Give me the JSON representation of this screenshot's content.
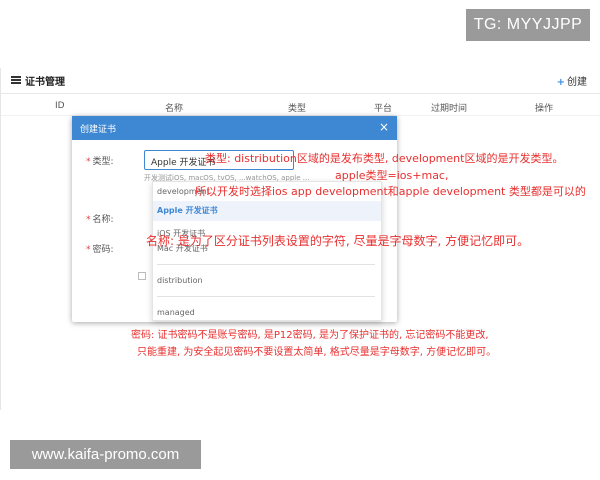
{
  "watermark_top": "TG: MYYJJPP",
  "watermark_bottom": "www.kaifa-promo.com",
  "page": {
    "title": "证书管理",
    "create_label": "创建",
    "table_headers": [
      "ID",
      "名称",
      "类型",
      "平台",
      "过期时间",
      "操作"
    ]
  },
  "dialog": {
    "title": "创建证书",
    "close": "×",
    "fields": {
      "type_label": "类型:",
      "type_value": "Apple 开发证书",
      "type_hint": "开发测试iOS, macOS, tvOS, ...watchOS, apple ...",
      "name_label": "名称:",
      "password_label": "密码:"
    },
    "dropdown_options": [
      "development",
      "Apple 开发证书",
      "iOS 开发证书",
      "Mac 开发证书",
      "distribution",
      "managed"
    ],
    "dropdown_selected_index": 1
  },
  "annotations": {
    "type_line1": "类型:  distribution区域的是发布类型, development区域的是开发类型。",
    "type_line2": "apple类型=ios+mac,",
    "type_line3": "所以开发时选择ios app development和apple development 类型都是可以的",
    "name_note": "名称: 是为了区分证书列表设置的字符, 尽量是字母数字, 方便记忆即可。",
    "password_line1": "密码: 证书密码不是账号密码, 是P12密码, 是为了保护证书的, 忘记密码不能更改,",
    "password_line2": "只能重建, 为安全起见密码不要设置太简单, 格式尽量是字母数字, 方便记忆即可。"
  },
  "colors": {
    "accent": "#3e88d3",
    "annotation": "#e82f2f",
    "watermark_bg": "#9a9a9a"
  }
}
